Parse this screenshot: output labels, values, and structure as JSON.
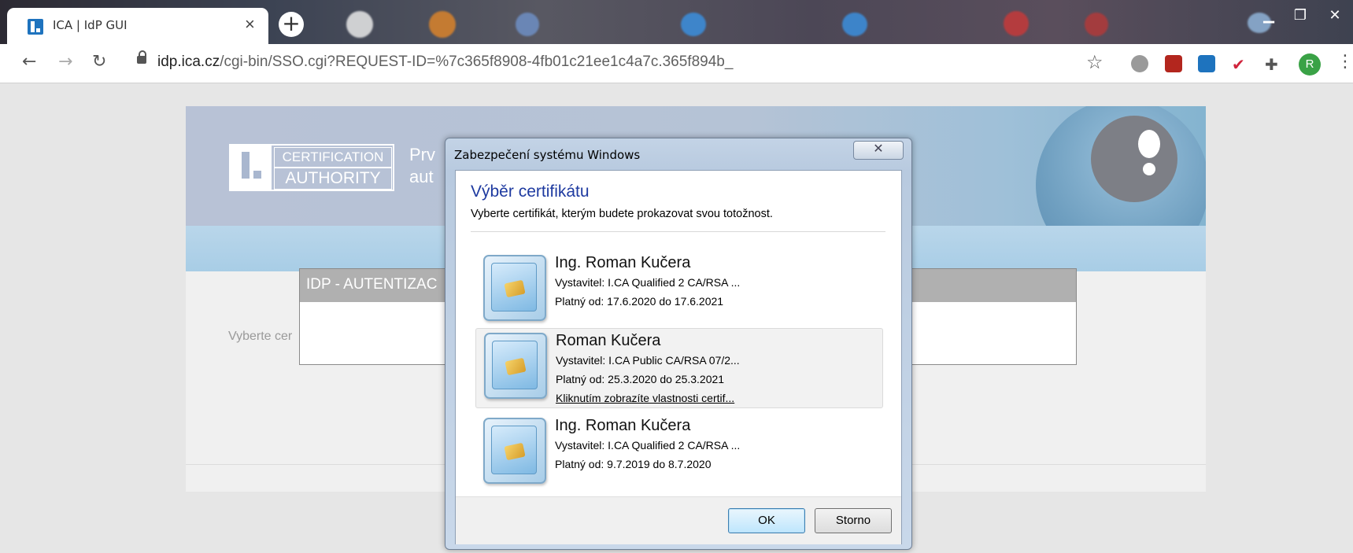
{
  "browser": {
    "tab_title": "ICA | IdP GUI",
    "tab_close": "×",
    "new_tab": "+",
    "url_host": "idp.ica.cz",
    "url_path": "/cgi-bin/SSO.cgi?REQUEST-ID=%7c365f8908-4fb01c21ee1c4a7c.365f894b_",
    "profile_initial": "R",
    "window_controls": [
      "▁",
      "❐",
      "✕"
    ]
  },
  "page": {
    "logo_line1": "CERTIFICATION",
    "logo_line2": "AUTHORITY",
    "banner_line1": "Prv",
    "banner_line2": "aut",
    "auth_header": "IDP - AUTENTIZAC",
    "select_label": "Vyberte cer"
  },
  "dialog": {
    "title": "Zabezpečení systému Windows",
    "heading": "Výběr certifikátu",
    "subtitle": "Vyberte certifikát, kterým budete prokazovat svou totožnost.",
    "certificates": [
      {
        "name": "Ing. Roman Kučera",
        "issuer": "Vystavitel: I.CA Qualified 2 CA/RSA ...",
        "validity": "Platný od: 17.6.2020 do 17.6.2021",
        "selected": false
      },
      {
        "name": "Roman Kučera",
        "issuer": "Vystavitel: I.CA Public CA/RSA 07/2...",
        "validity": "Platný od: 25.3.2020 do 25.3.2021",
        "link": "Kliknutím zobrazíte vlastnosti certif...",
        "selected": true
      },
      {
        "name": "Ing. Roman Kučera",
        "issuer": "Vystavitel: I.CA Qualified 2 CA/RSA ...",
        "validity": "Platný od: 9.7.2019 do 8.7.2020",
        "selected": false
      }
    ],
    "ok_label": "OK",
    "cancel_label": "Storno"
  },
  "icons": [
    "lock-icon",
    "star-icon",
    "extension-icons",
    "puzzle-icon",
    "kebab-menu-icon",
    "smartcard-icon"
  ]
}
